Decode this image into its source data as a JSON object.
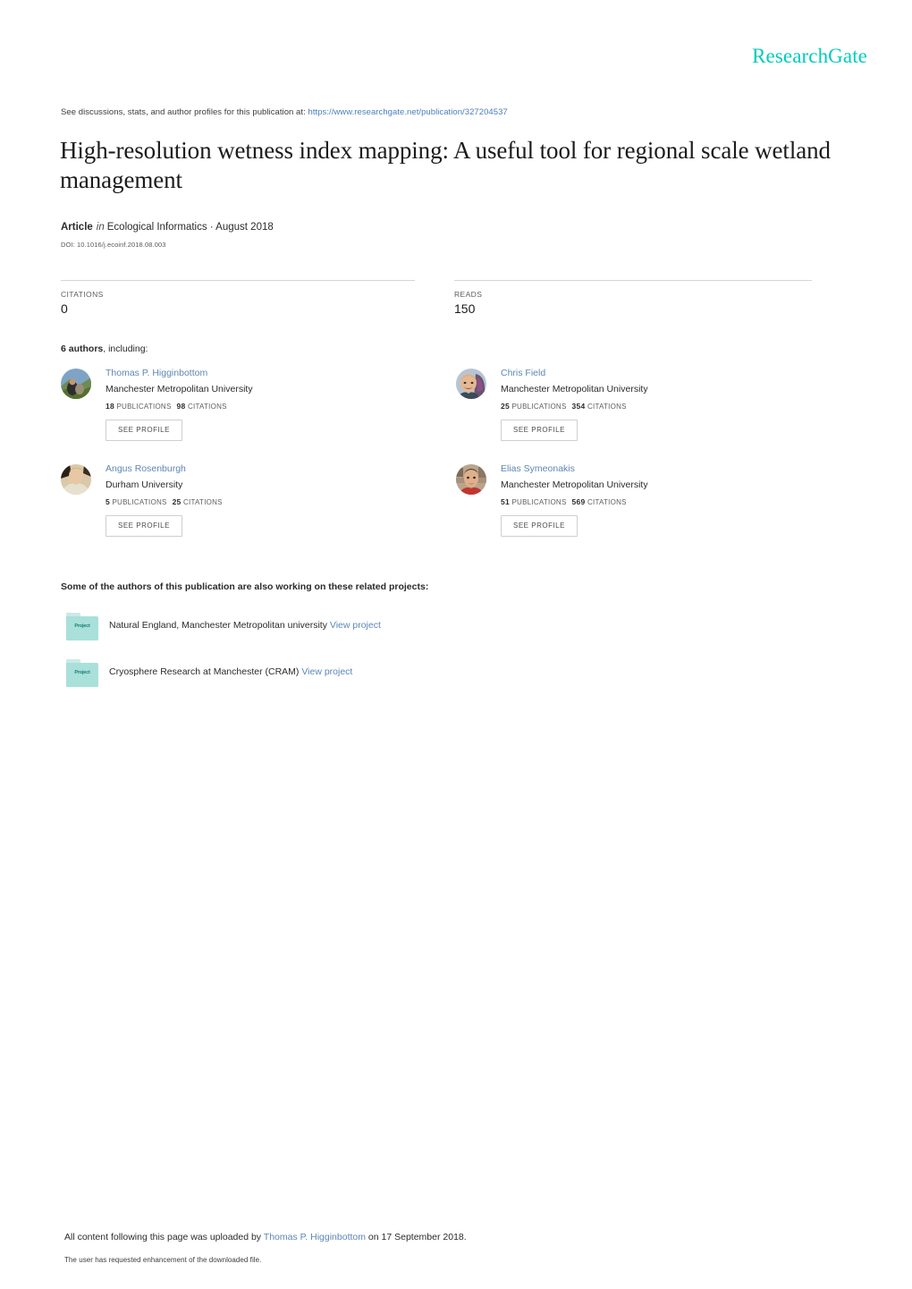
{
  "brand": {
    "logo_text": "ResearchGate",
    "logo_color": "#00ccbb",
    "link_color": "#5d87b4"
  },
  "header": {
    "discussions_prefix": "See discussions, stats, and author profiles for this publication at:",
    "publication_url": "https://www.researchgate.net/publication/327204537"
  },
  "publication": {
    "title": "High-resolution wetness index mapping: A useful tool for regional scale wetland management",
    "type_label": "Article",
    "in_label": "in",
    "journal": "Ecological Informatics · August 2018",
    "doi": "DOI: 10.1016/j.ecoinf.2018.08.003"
  },
  "stats": {
    "citations_label": "CITATIONS",
    "citations_value": "0",
    "reads_label": "READS",
    "reads_value": "150"
  },
  "authors_section": {
    "heading_count": "6 authors",
    "heading_suffix": ", including:",
    "see_profile_label": "SEE PROFILE",
    "publications_label": "PUBLICATIONS",
    "citations_label": "CITATIONS",
    "authors": [
      {
        "name": "Thomas P. Higginbottom",
        "institution": "Manchester Metropolitan University",
        "publications": "18",
        "citations": "98",
        "avatar": "avatar-higginbottom"
      },
      {
        "name": "Chris Field",
        "institution": "Manchester Metropolitan University",
        "publications": "25",
        "citations": "354",
        "avatar": "avatar-field"
      },
      {
        "name": "Angus Rosenburgh",
        "institution": "Durham University",
        "publications": "5",
        "citations": "25",
        "avatar": "avatar-rosenburgh"
      },
      {
        "name": "Elias Symeonakis",
        "institution": "Manchester Metropolitan University",
        "publications": "51",
        "citations": "569",
        "avatar": "avatar-symeonakis"
      }
    ]
  },
  "projects_section": {
    "heading": "Some of the authors of this publication are also working on these related projects:",
    "icon_label": "Project",
    "view_label": "View project",
    "projects": [
      {
        "title": "Natural England, Manchester Metropolitan university"
      },
      {
        "title": "Cryosphere Research at Manchester (CRAM)"
      }
    ]
  },
  "footer": {
    "upload_prefix": "All content following this page was uploaded by",
    "uploader": "Thomas P. Higginbottom",
    "upload_suffix": "on 17 September 2018.",
    "enhancement_note": "The user has requested enhancement of the downloaded file."
  }
}
